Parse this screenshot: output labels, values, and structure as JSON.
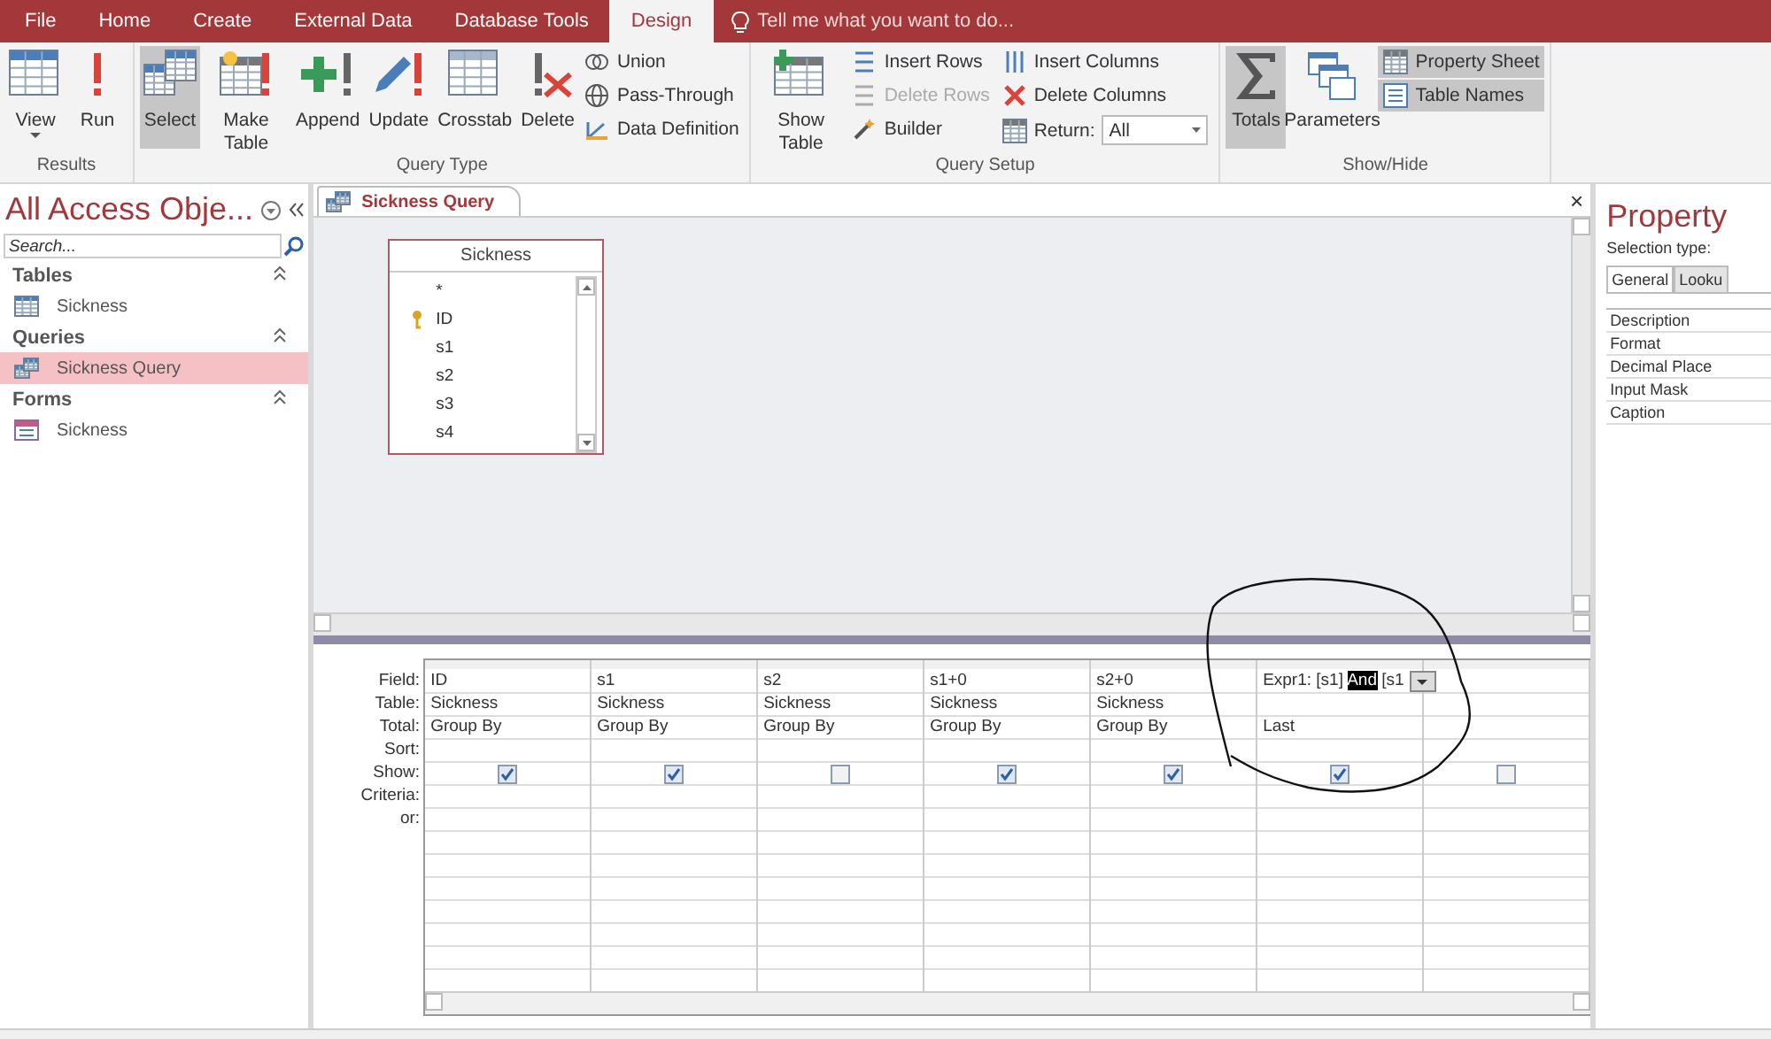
{
  "ribbon": {
    "tabs": [
      {
        "label": "File",
        "selected": false
      },
      {
        "label": "Home",
        "selected": false
      },
      {
        "label": "Create",
        "selected": false
      },
      {
        "label": "External Data",
        "selected": false
      },
      {
        "label": "Database Tools",
        "selected": false
      },
      {
        "label": "Design",
        "selected": true
      }
    ],
    "tell_me": "Tell me what you want to do...",
    "groups": [
      {
        "label": "Results",
        "items": [
          {
            "kind": "big",
            "label": "View",
            "selected": false,
            "dropdown": true
          },
          {
            "kind": "big",
            "label": "Run",
            "selected": false
          }
        ]
      },
      {
        "label": "Query Type",
        "items": [
          {
            "kind": "big",
            "label": "Select",
            "selected": true
          },
          {
            "kind": "big",
            "label": "Make Table",
            "selected": false
          },
          {
            "kind": "big",
            "label": "Append",
            "selected": false
          },
          {
            "kind": "big",
            "label": "Update",
            "selected": false
          },
          {
            "kind": "big",
            "label": "Crosstab",
            "selected": false
          },
          {
            "kind": "big",
            "label": "Delete",
            "selected": false
          },
          {
            "kind": "stack",
            "items": [
              {
                "kind": "small",
                "label": "Union",
                "selected": false,
                "disabled": false
              },
              {
                "kind": "small",
                "label": "Pass-Through",
                "selected": false,
                "disabled": false
              },
              {
                "kind": "small",
                "label": "Data Definition",
                "selected": false,
                "disabled": false
              }
            ]
          }
        ]
      },
      {
        "label": "Query Setup",
        "items": [
          {
            "kind": "big",
            "label": "Show Table",
            "selected": false
          },
          {
            "kind": "stack",
            "items": [
              {
                "kind": "small",
                "label": "Insert Rows",
                "selected": false,
                "disabled": false
              },
              {
                "kind": "small",
                "label": "Delete Rows",
                "selected": false,
                "disabled": true
              },
              {
                "kind": "small",
                "label": "Builder",
                "selected": false,
                "disabled": false
              }
            ]
          },
          {
            "kind": "stack",
            "items": [
              {
                "kind": "small",
                "label": "Insert Columns",
                "selected": false,
                "disabled": false
              },
              {
                "kind": "small",
                "label": "Delete Columns",
                "selected": false,
                "disabled": false
              },
              {
                "kind": "combo",
                "label": "Return:",
                "value": "All"
              }
            ]
          }
        ]
      },
      {
        "label": "Show/Hide",
        "items": [
          {
            "kind": "big",
            "label": "Totals",
            "selected": true
          },
          {
            "kind": "big",
            "label": "Parameters",
            "selected": false
          },
          {
            "kind": "stack",
            "items": [
              {
                "kind": "small",
                "label": "Property Sheet",
                "selected": true,
                "disabled": false
              },
              {
                "kind": "small",
                "label": "Table Names",
                "selected": true,
                "disabled": false
              }
            ]
          }
        ]
      }
    ]
  },
  "nav": {
    "title": "All Access Obje...",
    "search": {
      "placeholder": "Search..."
    },
    "sections": [
      {
        "label": "Tables",
        "items": [
          {
            "kind": "table",
            "label": "Sickness",
            "selected": false
          }
        ]
      },
      {
        "label": "Queries",
        "items": [
          {
            "kind": "query",
            "label": "Sickness Query",
            "selected": true
          }
        ]
      },
      {
        "label": "Forms",
        "items": [
          {
            "kind": "form",
            "label": "Sickness",
            "selected": false
          }
        ]
      }
    ]
  },
  "document": {
    "tab": "Sickness Query",
    "close": "×",
    "field_list": {
      "title": "Sickness",
      "fields": [
        {
          "name": "*",
          "key": false
        },
        {
          "name": "ID",
          "key": true
        },
        {
          "name": "s1",
          "key": false
        },
        {
          "name": "s2",
          "key": false
        },
        {
          "name": "s3",
          "key": false
        },
        {
          "name": "s4",
          "key": false
        }
      ]
    },
    "grid": {
      "row_labels": [
        "Field:",
        "Table:",
        "Total:",
        "Sort:",
        "Show:",
        "Criteria:",
        "or:"
      ],
      "columns": [
        {
          "field": [
            {
              "text": "ID",
              "selected": false
            }
          ],
          "table": "Sickness",
          "total": "Group By",
          "show": true
        },
        {
          "field": [
            {
              "text": "s1",
              "selected": false
            }
          ],
          "table": "Sickness",
          "total": "Group By",
          "show": true
        },
        {
          "field": [
            {
              "text": "s2",
              "selected": false
            }
          ],
          "table": "Sickness",
          "total": "Group By",
          "show": false
        },
        {
          "field": [
            {
              "text": "s1+0",
              "selected": false
            }
          ],
          "table": "Sickness",
          "total": "Group By",
          "show": true
        },
        {
          "field": [
            {
              "text": "s2+0",
              "selected": false
            }
          ],
          "table": "Sickness",
          "total": "Group By",
          "show": true
        },
        {
          "field": [
            {
              "text": "Expr1: [s1] ",
              "selected": false
            },
            {
              "text": "And",
              "selected": true
            },
            {
              "text": " [s1",
              "selected": false
            }
          ],
          "dropdown": true,
          "total": "Last",
          "show": true
        },
        {
          "show": false
        }
      ]
    }
  },
  "property_sheet": {
    "title": "Property",
    "selection_type": "Selection type:",
    "tabs": [
      {
        "label": "General",
        "selected": true
      },
      {
        "label": "Looku",
        "selected": false
      }
    ],
    "properties": [
      "Description",
      "Format",
      "Decimal Place",
      "Input Mask",
      "Caption"
    ]
  }
}
